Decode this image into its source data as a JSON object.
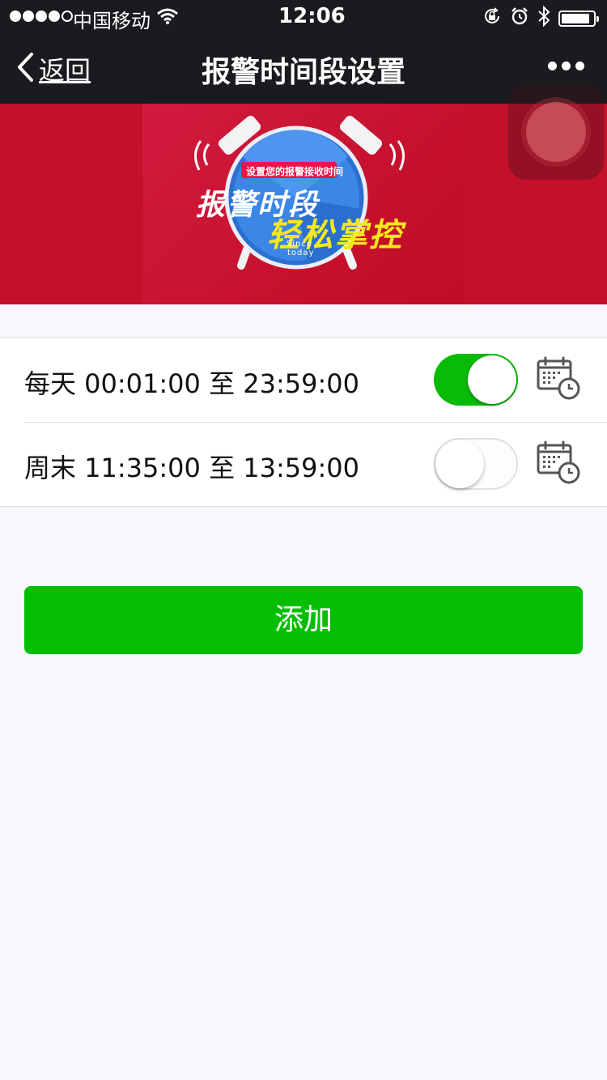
{
  "status_bar": {
    "signal_dots": 5,
    "signal_filled": 4,
    "carrier": "中国移动",
    "time": "12:06",
    "battery_percent": 90
  },
  "navbar": {
    "back_label": "返回",
    "title": "报警时间段设置"
  },
  "banner": {
    "tagline": "设置您的报警接收时间",
    "headline_1": "报警时段",
    "headline_2": "轻松掌控",
    "since": "Since",
    "today": "today"
  },
  "schedules": [
    {
      "text": "每天 00:01:00 至 23:59:00",
      "enabled": true
    },
    {
      "text": "周末 11:35:00 至 13:59:00",
      "enabled": false
    }
  ],
  "add_button_label": "添加",
  "colors": {
    "toggle_on": "#09bb07",
    "add_button": "#04be02",
    "banner_red": "#c3102b",
    "navbar": "#1b1a1f"
  }
}
